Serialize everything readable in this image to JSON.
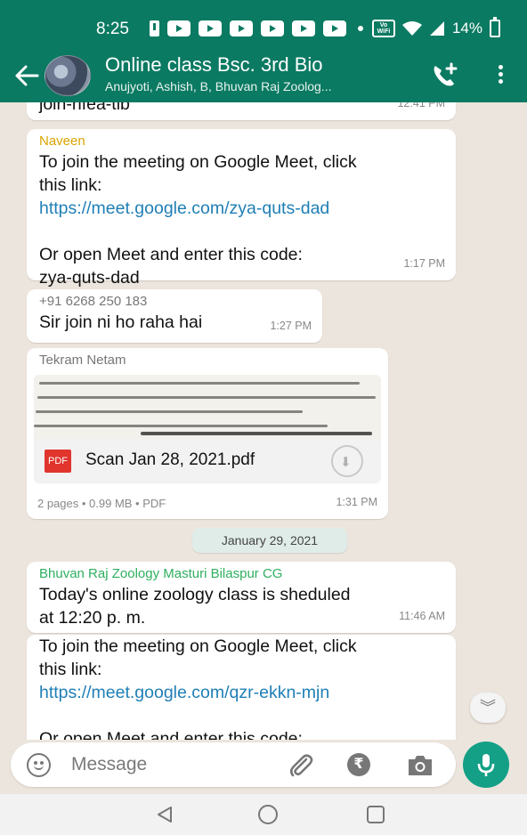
{
  "status_bar": {
    "time": "8:25",
    "wifi_badge": "Vo WiFi",
    "battery_percent": "14%"
  },
  "header": {
    "title": "Online class Bsc. 3rd Bio",
    "subtitle": "Anujyoti, Ashish, B, Bhuvan Raj Zoolog..."
  },
  "messages": [
    {
      "text": "join-nfea-tib",
      "time": "12:41 PM"
    },
    {
      "sender": "Naveen",
      "sender_color": "#d9a400",
      "line1": "To join the meeting on Google Meet, click",
      "line2": "this link:",
      "link": "https://meet.google.com/zya-quts-dad",
      "line3": "Or open Meet and enter this code:",
      "line4": "zya-quts-dad",
      "time": "1:17 PM"
    },
    {
      "sender": "+91 6268 250 183",
      "sender_color": "#777777",
      "text": "Sir join ni ho raha hai",
      "time": "1:27 PM"
    },
    {
      "sender": "Tekram Netam",
      "sender_color": "#777777",
      "document_name": "Scan Jan 28, 2021.pdf",
      "document_badge": "PDF",
      "document_meta": "2 pages • 0.99 MB • PDF",
      "time": "1:31 PM"
    },
    {
      "date_chip": "January 29, 2021"
    },
    {
      "sender": "Bhuvan Raj Zoology Masturi Bilaspur CG",
      "sender_color": "#2faf5f",
      "line1": "Today's online zoology class is sheduled",
      "line2": "at 12:20 p. m.",
      "time": "11:46 AM"
    },
    {
      "line1": "To join the meeting on Google Meet, click",
      "line2": "this link:",
      "link": "https://meet.google.com/qzr-ekkn-mjn",
      "line3": "Or open Meet and enter this code:"
    }
  ],
  "input_bar": {
    "placeholder": "Message",
    "rupee_symbol": "₹"
  },
  "scroll_button_icon": "chevrons-down-icon",
  "colors": {
    "header_green": "#0b7a62",
    "chat_background": "#ece5dd",
    "mic_green": "#13a087",
    "link_blue": "#1f7fb6"
  }
}
